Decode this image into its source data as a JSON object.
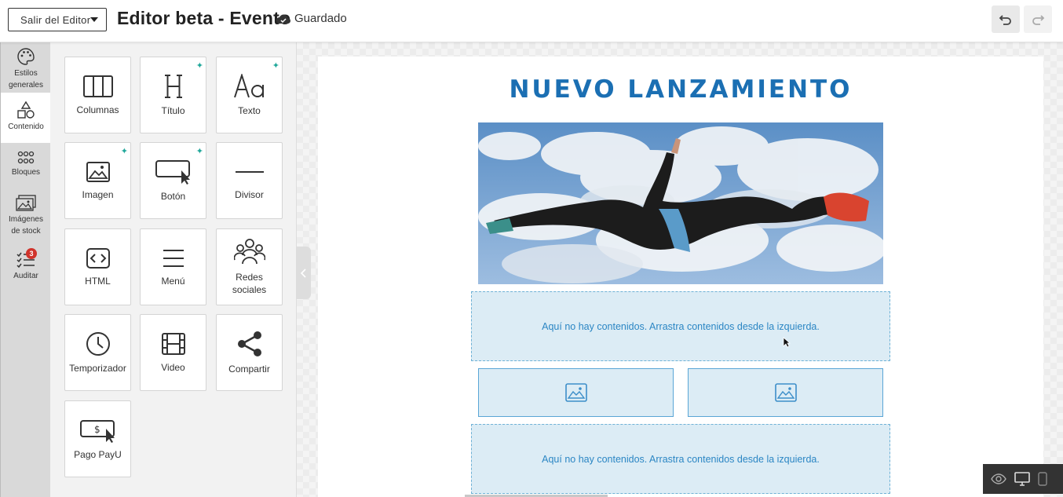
{
  "header": {
    "exit_label": "Salir del Editor",
    "title": "Editor beta - Evento",
    "saved_label": "Guardado"
  },
  "rail": {
    "items": [
      {
        "label": "Estilos generales",
        "icon": "palette-icon"
      },
      {
        "label": "Contenido",
        "icon": "shapes-icon"
      },
      {
        "label": "Bloques",
        "icon": "grid-icon"
      },
      {
        "label": "Imágenes de stock",
        "icon": "images-icon"
      },
      {
        "label": "Auditar",
        "icon": "checklist-icon",
        "badge": "3"
      }
    ],
    "active": "Contenido"
  },
  "content_tiles": [
    {
      "label": "Columnas",
      "icon": "columns-icon",
      "new": false
    },
    {
      "label": "Título",
      "icon": "heading-icon",
      "new": true
    },
    {
      "label": "Texto",
      "icon": "text-icon",
      "new": true
    },
    {
      "label": "Imagen",
      "icon": "image-icon",
      "new": true
    },
    {
      "label": "Botón",
      "icon": "button-icon",
      "new": true
    },
    {
      "label": "Divisor",
      "icon": "divider-icon",
      "new": false
    },
    {
      "label": "HTML",
      "icon": "code-icon",
      "new": false
    },
    {
      "label": "Menú",
      "icon": "menu-icon",
      "new": false
    },
    {
      "label": "Redes sociales",
      "icon": "social-icon",
      "new": false
    },
    {
      "label": "Temporizador",
      "icon": "clock-icon",
      "new": false
    },
    {
      "label": "Video",
      "icon": "film-icon",
      "new": false
    },
    {
      "label": "Compartir",
      "icon": "share-icon",
      "new": false
    },
    {
      "label": "Pago PayU",
      "icon": "payment-icon",
      "new": false
    }
  ],
  "canvas": {
    "headline": "NUEVO LANZAMIENTO",
    "empty_zone_text": "Aquí no hay contenidos. Arrastra contenidos desde la izquierda.",
    "empty_zone_text_2": "Aquí no hay contenidos. Arrastra contenidos desde la izquierda."
  },
  "colors": {
    "accent": "#1b6fb3",
    "dropzone_bg": "#dcecf5",
    "dropzone_border": "#6fb2d6",
    "badge": "#d0342c",
    "sparkle": "#22a89b"
  }
}
